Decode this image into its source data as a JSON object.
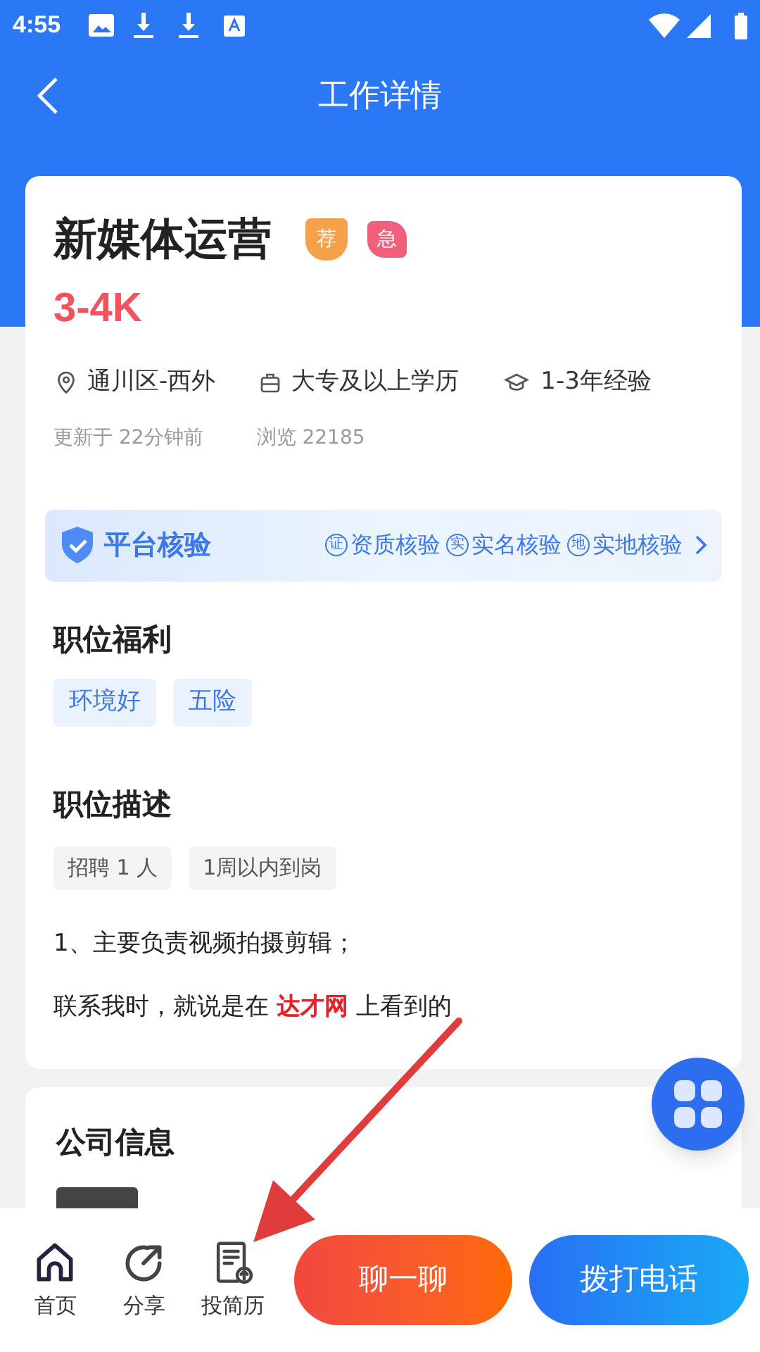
{
  "status_bar": {
    "time": "4:55"
  },
  "header": {
    "title": "工作详情"
  },
  "job": {
    "title": "新媒体运营",
    "badges": [
      {
        "label": "荐",
        "kind": "shield"
      },
      {
        "label": "急",
        "kind": "leaf"
      }
    ],
    "salary": "3-4K",
    "facts": [
      {
        "kind": "location",
        "text": "通川区-西外"
      },
      {
        "kind": "education",
        "text": "大专及以上学历"
      },
      {
        "kind": "experience",
        "text": "1-3年经验"
      }
    ],
    "updated": "更新于 22分钟前",
    "views": "浏览 22185"
  },
  "verification": {
    "title": "平台核验",
    "items": [
      {
        "mark": "证",
        "text": "资质核验"
      },
      {
        "mark": "实",
        "text": "实名核验"
      },
      {
        "mark": "地",
        "text": "实地核验"
      }
    ]
  },
  "benefits": {
    "heading": "职位福利",
    "tags": [
      "环境好",
      "五险"
    ]
  },
  "description": {
    "heading": "职位描述",
    "tags": [
      "招聘 1 人",
      "1周以内到岗"
    ],
    "lines": [
      "1、主要负责视频拍摄剪辑；",
      "联系我时，就说是在 **达才网** 上看到的"
    ]
  },
  "company": {
    "heading": "公司信息"
  },
  "bottom_nav": [
    {
      "kind": "home",
      "label": "首页"
    },
    {
      "kind": "share",
      "label": "分享"
    },
    {
      "kind": "resume",
      "label": "投简历"
    }
  ],
  "actions": [
    {
      "kind": "chat",
      "label": "聊一聊"
    },
    {
      "kind": "call",
      "label": "拨打电话"
    }
  ]
}
